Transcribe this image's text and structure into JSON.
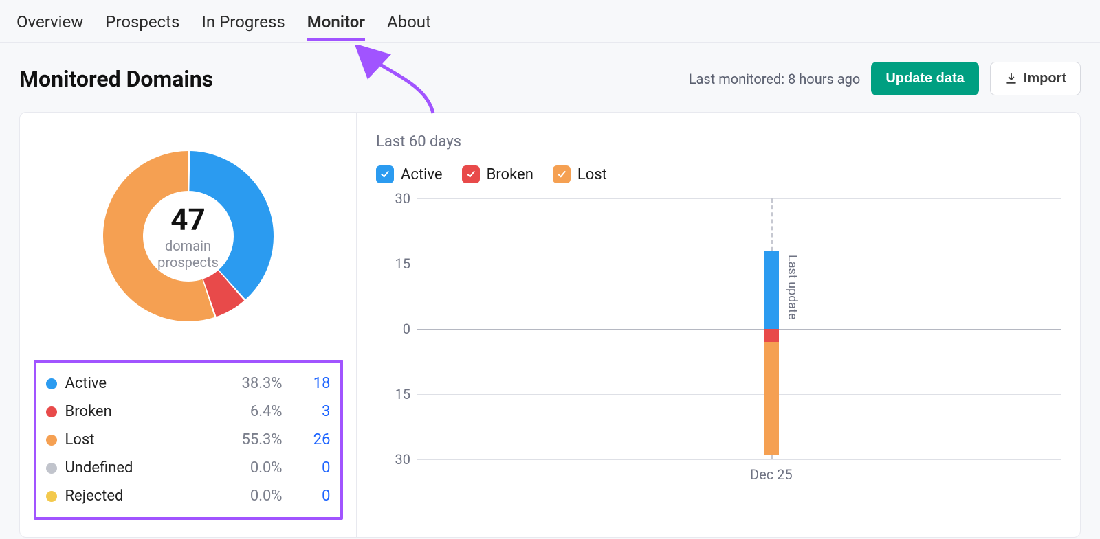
{
  "tabs": [
    {
      "label": "Overview",
      "active": false
    },
    {
      "label": "Prospects",
      "active": false
    },
    {
      "label": "In Progress",
      "active": false
    },
    {
      "label": "Monitor",
      "active": true
    },
    {
      "label": "About",
      "active": false
    }
  ],
  "header": {
    "title": "Monitored Domains",
    "last_monitored": "Last monitored: 8 hours ago",
    "update_label": "Update data",
    "import_label": "Import"
  },
  "colors": {
    "active": "#2b9bf0",
    "broken": "#e84a4a",
    "lost": "#f5a052",
    "undefined": "#c1c4cc",
    "rejected": "#f3c94d",
    "accent_purple": "#a154ff",
    "primary_green": "#009f81"
  },
  "donut": {
    "total": "47",
    "sub_l1": "domain",
    "sub_l2": "prospects"
  },
  "legend": [
    {
      "key": "active",
      "label": "Active",
      "pct": "38.3%",
      "count": "18"
    },
    {
      "key": "broken",
      "label": "Broken",
      "pct": "6.4%",
      "count": "3"
    },
    {
      "key": "lost",
      "label": "Lost",
      "pct": "55.3%",
      "count": "26"
    },
    {
      "key": "undefined",
      "label": "Undefined",
      "pct": "0.0%",
      "count": "0"
    },
    {
      "key": "rejected",
      "label": "Rejected",
      "pct": "0.0%",
      "count": "0"
    }
  ],
  "right": {
    "subtitle": "Last 60 days",
    "series": [
      {
        "key": "active",
        "label": "Active"
      },
      {
        "key": "broken",
        "label": "Broken"
      },
      {
        "key": "lost",
        "label": "Lost"
      }
    ],
    "last_update_label": "Last update"
  },
  "chart_data": {
    "type": "bar",
    "title": "Last 60 days",
    "xlabel": "",
    "ylabel": "",
    "ylim": [
      -30,
      30
    ],
    "yticks": [
      30,
      15,
      0,
      -15,
      -30
    ],
    "ytick_labels": [
      "30",
      "15",
      "0",
      "15",
      "30"
    ],
    "categories": [
      "Dec 25"
    ],
    "series": [
      {
        "name": "Active",
        "values": [
          18
        ]
      },
      {
        "name": "Broken",
        "values": [
          -3
        ]
      },
      {
        "name": "Lost",
        "values": [
          -26
        ]
      }
    ],
    "annotations": [
      "Last update"
    ]
  }
}
